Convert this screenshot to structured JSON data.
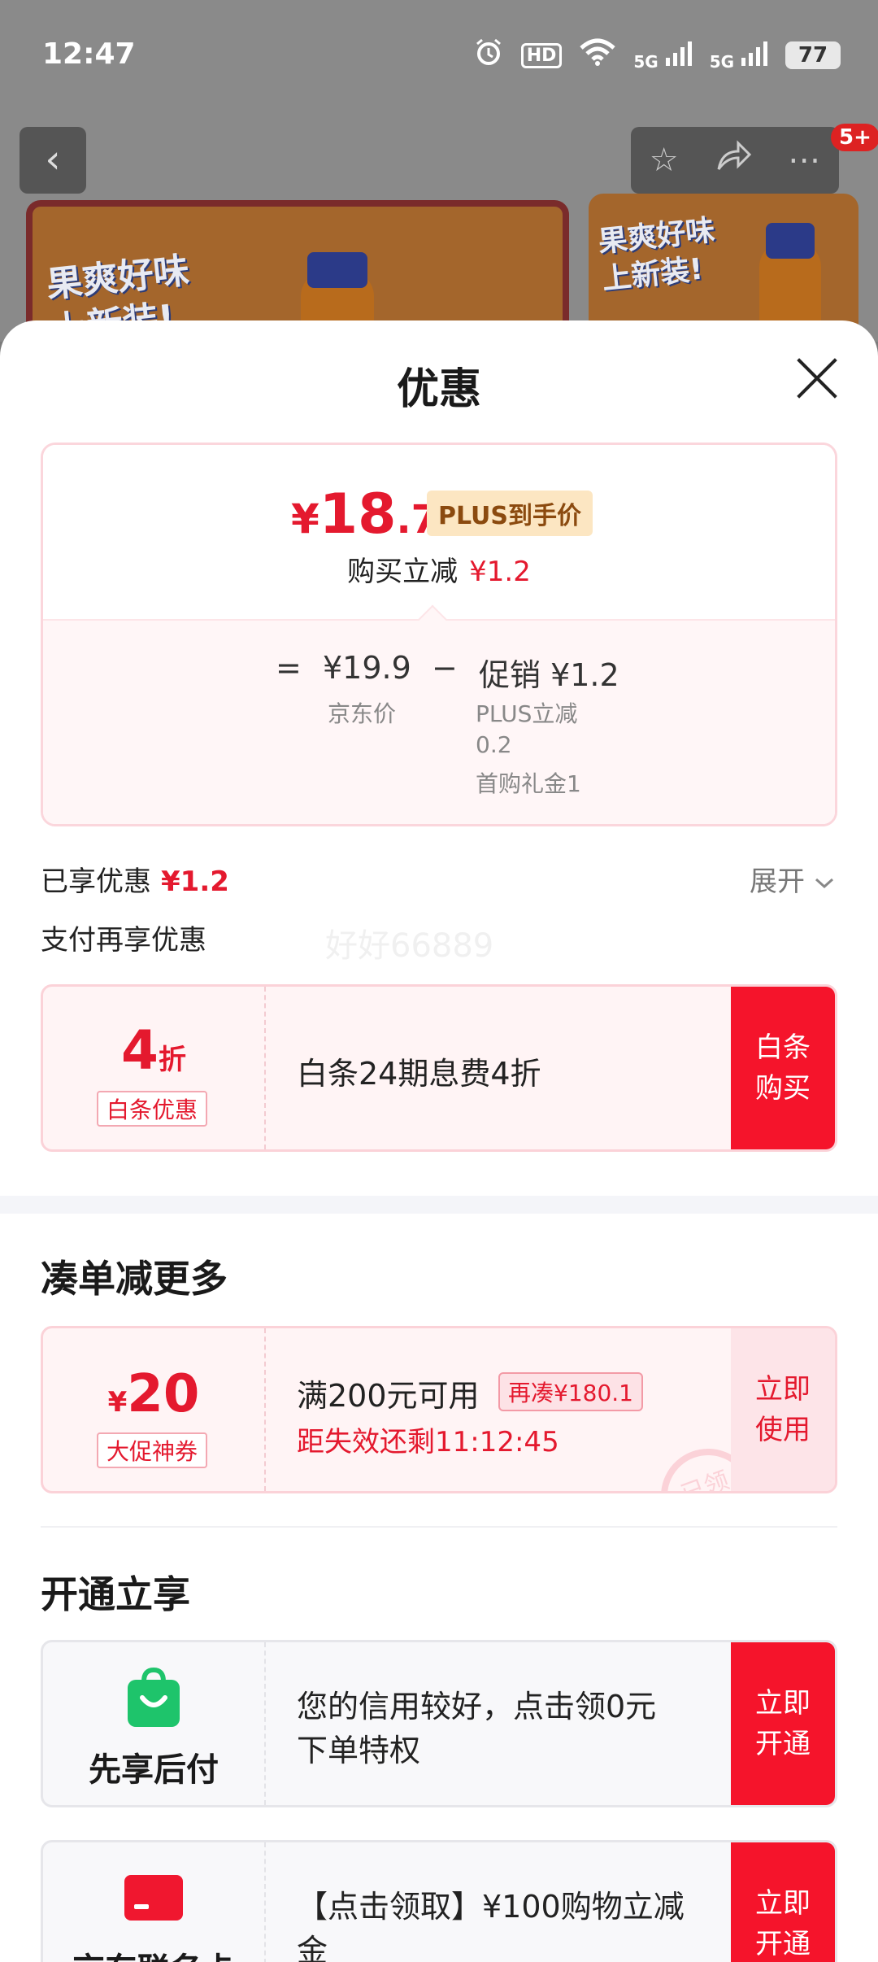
{
  "status_bar": {
    "time": "12:47",
    "icons": [
      "alarm-icon",
      "hd-icon",
      "wifi-icon",
      "5g-signal-icon",
      "5g-signal-icon",
      "battery-icon"
    ],
    "hd_label": "HD",
    "net_label_1": "5G",
    "net_label_2": "5G",
    "battery": "77"
  },
  "top_nav": {
    "back_icon": "chevron-left-icon",
    "star_icon": "star-icon",
    "share_icon": "share-icon",
    "more_icon": "more-icon",
    "badge": "5+"
  },
  "banner": {
    "text_line1": "果爽好味",
    "text_line2": "上新装!"
  },
  "sheet": {
    "title": "优惠",
    "close_icon": "close-icon"
  },
  "price_card": {
    "currency": "¥",
    "price_int": "18",
    "price_dec": ".7",
    "plus_tag": "PLUS到手价",
    "reduce_label": "购买立减",
    "reduce_value": "¥1.2",
    "equals": "=",
    "jd_price": "¥19.9",
    "jd_price_label": "京东价",
    "minus": "−",
    "promo": "促销 ¥1.2",
    "promo_detail_1": "PLUS立减",
    "promo_detail_2": "0.2",
    "promo_detail_3": "首购礼金1"
  },
  "enjoyed": {
    "label": "已享优惠",
    "value": "¥1.2",
    "expand": "展开"
  },
  "pay_more": {
    "label": "支付再享优惠",
    "watermark": "好好66889"
  },
  "baitiao": {
    "discount_num": "4",
    "discount_unit": "折",
    "tag": "白条优惠",
    "text": "白条24期息费4折",
    "action_line1": "白条",
    "action_line2": "购买"
  },
  "bundle": {
    "title": "凑单减更多",
    "currency": "¥",
    "amount": "20",
    "tag": "大促神券",
    "condition": "满200元可用",
    "again_tag": "再凑¥180.1",
    "countdown": "距失效还剩11:12:45",
    "stamp": "已领",
    "action_line1": "立即",
    "action_line2": "使用"
  },
  "open_enjoy": {
    "title": "开通立享",
    "items": [
      {
        "icon": "shopping-bag-icon",
        "name": "先享后付",
        "text_line1": "您的信用较好，点击领0元",
        "text_line2": "下单特权",
        "action_line1": "立即",
        "action_line2": "开通"
      },
      {
        "icon": "credit-card-icon",
        "name": "京东联名卡",
        "text_line1": "【点击领取】¥100购物立减",
        "text_line2": "金",
        "action_line1": "立即",
        "action_line2": "开通"
      }
    ]
  },
  "colors": {
    "accent_red": "#f5142b",
    "price_red": "#e4192e",
    "plus_gold_bg": "#fce6c2",
    "success_green": "#1ec46b"
  }
}
